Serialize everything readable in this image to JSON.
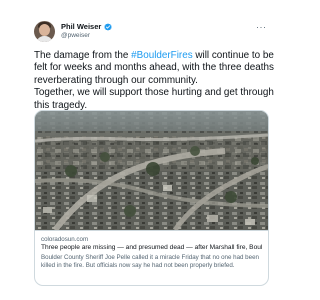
{
  "author": {
    "display_name": "Phil Weiser",
    "handle": "@pweiser",
    "verified": true
  },
  "menu": {
    "more_label": "···"
  },
  "tweet": {
    "line1_before": "The damage from the ",
    "hashtag": "#BoulderFires",
    "line1_after": " will continue to be felt for weeks and months ahead, with the three deaths reverberating through our community.",
    "line2": "Together, we will support those hurting and get through this tragedy."
  },
  "link_card": {
    "image_description_icon": "aerial-burned-neighborhood",
    "domain": "coloradosun.com",
    "title": "Three people are missing — and presumed dead — after Marshall fire, Boulder ...",
    "description": "Boulder County Sheriff Joe Pelle called it a miracle Friday that no one had been killed in the fire. But officials now say he had not been properly briefed."
  },
  "colors": {
    "hashtag": "#1d9bf0",
    "verified_badge": "#1d9bf0",
    "secondary_text": "#536471",
    "border": "#cfd9de"
  }
}
